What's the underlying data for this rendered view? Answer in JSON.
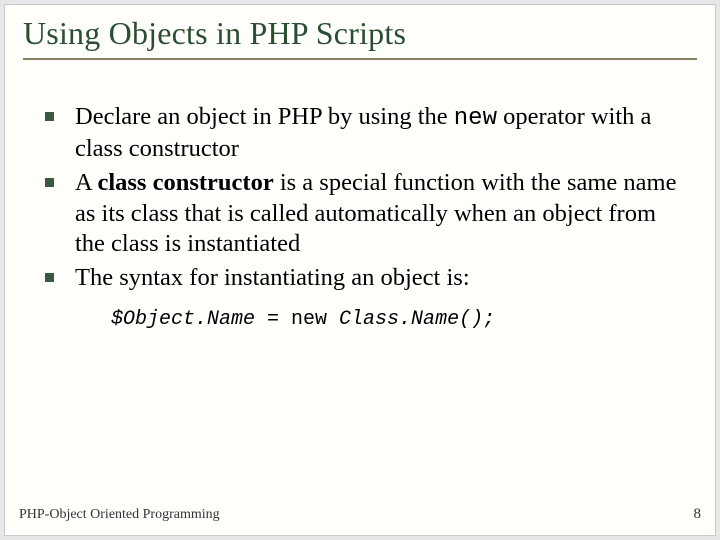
{
  "title": "Using Objects in PHP Scripts",
  "bullets": {
    "b1a": "Declare an object in PHP by using the ",
    "b1_kw": "new",
    "b1b": " operator with a class constructor",
    "b2a": "A ",
    "b2_bold": "class constructor",
    "b2b": " is a special function with the same name as its class that is called automatically when an object from the class is instantiated",
    "b3": "The syntax for instantiating an object is:"
  },
  "code": {
    "c1": "$Object.Name",
    "c2": " = new ",
    "c3": "Class.Name();"
  },
  "footer": {
    "left": "PHP-Object Oriented Programming",
    "right": "8"
  }
}
